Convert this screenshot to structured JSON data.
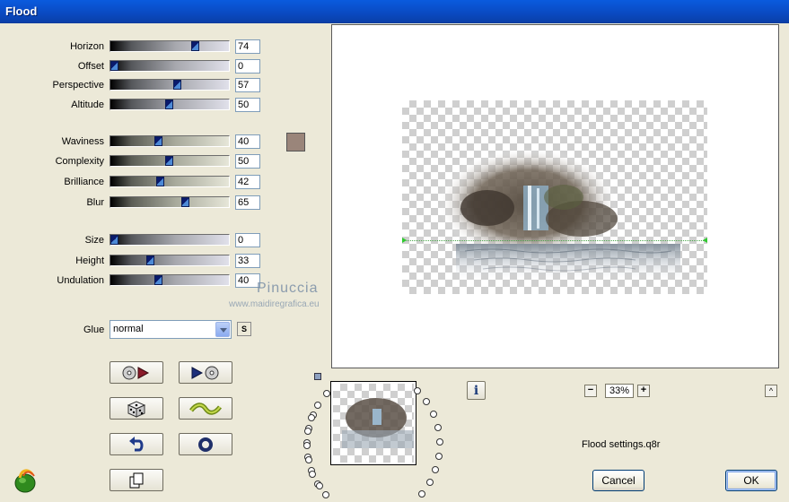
{
  "window": {
    "title": "Flood"
  },
  "sliders": [
    {
      "label": "Horizon",
      "value": "74",
      "level": 0.74
    },
    {
      "label": "Offset",
      "value": "0",
      "level": 0.0
    },
    {
      "label": "Perspective",
      "value": "57",
      "level": 0.57
    },
    {
      "label": "Altitude",
      "value": "50",
      "level": 0.5
    },
    {
      "label": "Waviness",
      "value": "40",
      "level": 0.4
    },
    {
      "label": "Complexity",
      "value": "50",
      "level": 0.5
    },
    {
      "label": "Brilliance",
      "value": "42",
      "level": 0.42
    },
    {
      "label": "Blur",
      "value": "65",
      "level": 0.65
    },
    {
      "label": "Size",
      "value": "0",
      "level": 0.0
    },
    {
      "label": "Height",
      "value": "33",
      "level": 0.33
    },
    {
      "label": "Undulation",
      "value": "40",
      "level": 0.4
    }
  ],
  "color_swatch": "#9a857a",
  "glue": {
    "label": "Glue",
    "value": "normal"
  },
  "small_button": "S",
  "zoom": {
    "value": "33%",
    "minus": "−",
    "plus": "+"
  },
  "settings_file": "Flood settings.q8r",
  "buttons": {
    "cancel": "Cancel",
    "ok": "OK"
  },
  "watermark": {
    "main": "Pinuccia",
    "sub": "www.maidiregrafica.eu"
  },
  "info_glyph": "i",
  "up_glyph": "^"
}
